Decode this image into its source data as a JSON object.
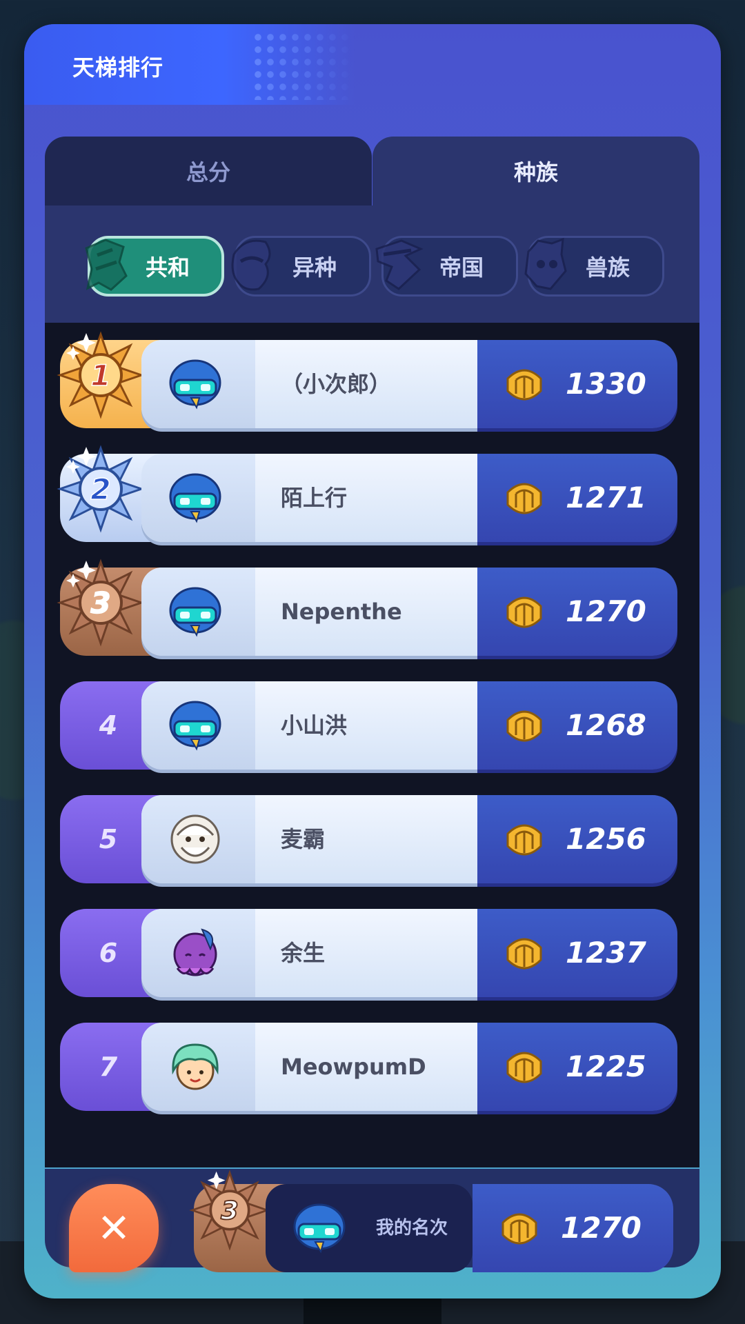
{
  "header": {
    "title": "天梯排行"
  },
  "tabs": [
    {
      "label": "总分",
      "active": false
    },
    {
      "label": "种族",
      "active": true
    }
  ],
  "races": [
    {
      "label": "共和",
      "active": true
    },
    {
      "label": "异种",
      "active": false
    },
    {
      "label": "帝国",
      "active": false
    },
    {
      "label": "兽族",
      "active": false
    }
  ],
  "rows": [
    {
      "rank": "1",
      "medal": "gold",
      "name": "（小次郎）",
      "score": "1330",
      "avatar": "blue-helmet-avatar"
    },
    {
      "rank": "2",
      "medal": "silver",
      "name": "陌上行",
      "score": "1271",
      "avatar": "blue-helmet-avatar"
    },
    {
      "rank": "3",
      "medal": "bronze",
      "name": "Nepenthe",
      "score": "1270",
      "avatar": "blue-helmet-avatar"
    },
    {
      "rank": "4",
      "medal": "none",
      "name": "小山洪",
      "score": "1268",
      "avatar": "blue-helmet-avatar"
    },
    {
      "rank": "5",
      "medal": "none",
      "name": "麦霸",
      "score": "1256",
      "avatar": "old-sage-avatar"
    },
    {
      "rank": "6",
      "medal": "none",
      "name": "余生",
      "score": "1237",
      "avatar": "purple-creature-avatar"
    },
    {
      "rank": "7",
      "medal": "none",
      "name": "MeowpumD",
      "score": "1225",
      "avatar": "green-hair-avatar"
    }
  ],
  "my_rank": {
    "rank": "3",
    "label": "我的名次",
    "score": "1270"
  },
  "colors": {
    "accent": "#1f8f7a",
    "close": "#f26a3c",
    "score_bg": "#3546b0"
  }
}
